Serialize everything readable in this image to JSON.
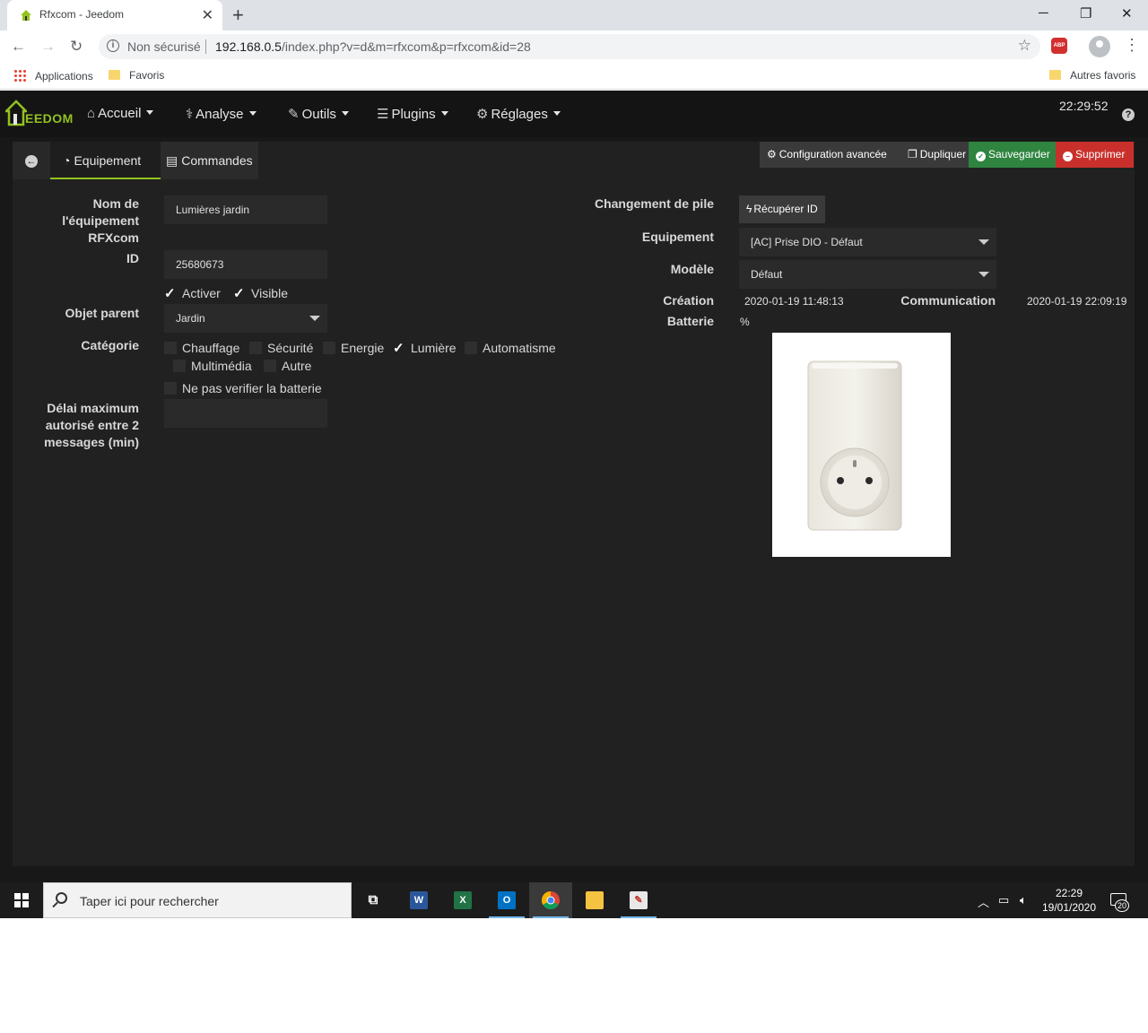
{
  "browser": {
    "tab_title": "Rfxcom - Jeedom",
    "security_label": "Non sécurisé",
    "url_host": "192.168.0.5",
    "url_path": "/index.php?v=d&m=rfxcom&p=rfxcom&id=28",
    "abp_label": "ABP",
    "bookmarks": {
      "apps": "Applications",
      "favoris": "Favoris",
      "autres": "Autres favoris"
    }
  },
  "jeedom": {
    "logo_text": "EEDOM",
    "clock": "22:29:52",
    "menu": [
      {
        "label": "Accueil",
        "icon": "home-icon"
      },
      {
        "label": "Analyse",
        "icon": "stethoscope-icon"
      },
      {
        "label": "Outils",
        "icon": "wrench-icon"
      },
      {
        "label": "Plugins",
        "icon": "list-icon"
      },
      {
        "label": "Réglages",
        "icon": "gear-icon"
      }
    ],
    "tabs": {
      "equipement": "Equipement",
      "commandes": "Commandes"
    },
    "actions": {
      "config": "Configuration avancée",
      "duplicate": "Dupliquer",
      "save": "Sauvegarder",
      "delete": "Supprimer"
    },
    "form": {
      "name_label": "Nom de l'équipement RFXcom",
      "name_value": "Lumières jardin",
      "id_label": "ID",
      "id_value": "25680673",
      "activer": "Activer",
      "visible": "Visible",
      "parent_label": "Objet parent",
      "parent_value": "Jardin",
      "category_label": "Catégorie",
      "categories": [
        {
          "label": "Chauffage",
          "checked": false
        },
        {
          "label": "Sécurité",
          "checked": false
        },
        {
          "label": "Energie",
          "checked": false
        },
        {
          "label": "Lumière",
          "checked": true
        },
        {
          "label": "Automatisme",
          "checked": false
        },
        {
          "label": "Multimédia",
          "checked": false
        },
        {
          "label": "Autre",
          "checked": false
        }
      ],
      "battery_check": "Ne pas verifier la batterie",
      "delay_label": "Délai maximum autorisé entre 2 messages (min)",
      "delay_value": ""
    },
    "right": {
      "pile_label": "Changement de pile",
      "recup_btn": "Récupérer ID",
      "equip_label": "Equipement",
      "equip_value": "[AC] Prise DIO - Défaut",
      "model_label": "Modèle",
      "model_value": "Défaut",
      "creation_label": "Création",
      "creation_value": "2020-01-19 11:48:13",
      "comm_label": "Communication",
      "comm_value": "2020-01-19 22:09:19",
      "battery_label": "Batterie",
      "battery_value": "%"
    }
  },
  "taskbar": {
    "search_placeholder": "Taper ici pour rechercher",
    "time": "22:29",
    "date": "19/01/2020",
    "notif_count": "20",
    "apps": [
      "task-view",
      "word",
      "excel",
      "outlook",
      "chrome",
      "explorer",
      "paint"
    ]
  },
  "colors": {
    "jeedom_green": "#94c11f",
    "save_green": "#2f8540",
    "delete_red": "#c9302c"
  }
}
